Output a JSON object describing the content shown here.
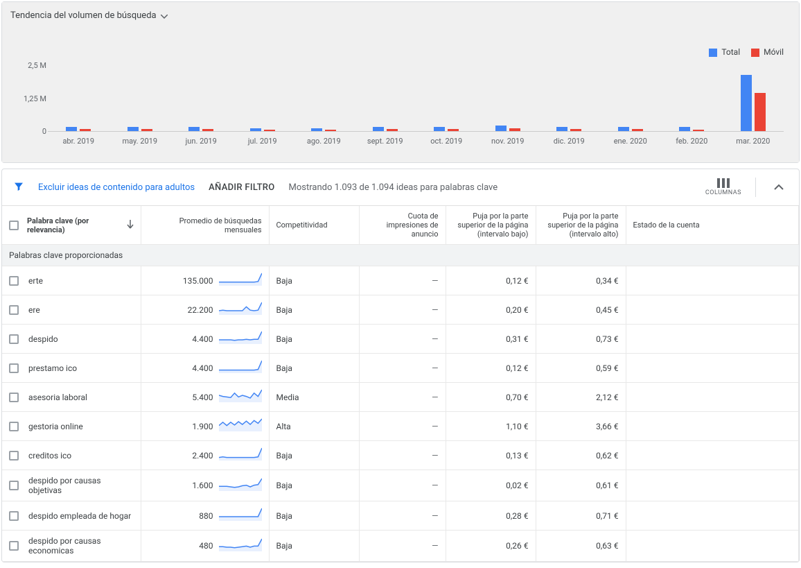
{
  "chart": {
    "title": "Tendencia del volumen de búsqueda",
    "legend": {
      "total": "Total",
      "movil": "Móvil"
    },
    "yticks": [
      "2,5 M",
      "1,25 M",
      "0"
    ]
  },
  "chart_data": {
    "type": "bar",
    "title": "Tendencia del volumen de búsqueda",
    "xlabel": "",
    "ylabel": "",
    "ylim": [
      0,
      2500000
    ],
    "categories": [
      "abr. 2019",
      "may. 2019",
      "jun. 2019",
      "jul. 2019",
      "ago. 2019",
      "sept. 2019",
      "oct. 2019",
      "nov. 2019",
      "dic. 2019",
      "ene. 2020",
      "feb. 2020",
      "mar. 2020"
    ],
    "series": [
      {
        "name": "Total",
        "color": "#4285f4",
        "values": [
          150000,
          150000,
          150000,
          110000,
          110000,
          150000,
          150000,
          200000,
          150000,
          150000,
          160000,
          2000000
        ]
      },
      {
        "name": "Móvil",
        "color": "#ea4335",
        "values": [
          80000,
          80000,
          80000,
          60000,
          60000,
          70000,
          70000,
          90000,
          70000,
          70000,
          50000,
          1350000
        ]
      }
    ]
  },
  "toolbar": {
    "exclude_adult": "Excluir ideas de contenido para adultos",
    "add_filter": "AÑADIR FILTRO",
    "status": "Mostrando 1.093 de 1.094 ideas para palabras clave",
    "columns": "COLUMNAS"
  },
  "table": {
    "headers": {
      "keyword": "Palabra clave (por relevancia)",
      "avg": "Promedio de búsquedas mensuales",
      "comp": "Competitividad",
      "quota": "Cuota de impresiones de anuncio",
      "bid_low": "Puja por la parte superior de la página (intervalo bajo)",
      "bid_high": "Puja por la parte superior de la página (intervalo alto)",
      "account": "Estado de la cuenta"
    },
    "section": "Palabras clave proporcionadas",
    "dash": "—",
    "rows": [
      {
        "kw": "erte",
        "avg": "135.000",
        "comp": "Baja",
        "low": "0,12 €",
        "high": "0,34 €",
        "spark": [
          4,
          4,
          4,
          4,
          4,
          4,
          4,
          4,
          4,
          4,
          5,
          20
        ]
      },
      {
        "kw": "ere",
        "avg": "22.200",
        "comp": "Baja",
        "low": "0,20 €",
        "high": "0,45 €",
        "spark": [
          5,
          6,
          5,
          5,
          5,
          5,
          5,
          12,
          6,
          5,
          6,
          20
        ]
      },
      {
        "kw": "despido",
        "avg": "4.400",
        "comp": "Baja",
        "low": "0,31 €",
        "high": "0,73 €",
        "spark": [
          5,
          5,
          5,
          5,
          4,
          5,
          5,
          6,
          5,
          6,
          6,
          20
        ]
      },
      {
        "kw": "prestamo ico",
        "avg": "4.400",
        "comp": "Baja",
        "low": "0,12 €",
        "high": "0,59 €",
        "spark": [
          3,
          3,
          3,
          3,
          3,
          3,
          3,
          3,
          3,
          3,
          4,
          20
        ]
      },
      {
        "kw": "asesoria laboral",
        "avg": "5.400",
        "comp": "Media",
        "low": "0,70 €",
        "high": "2,12 €",
        "spark": [
          10,
          8,
          7,
          6,
          14,
          7,
          10,
          8,
          5,
          14,
          8,
          20
        ]
      },
      {
        "kw": "gestoria online",
        "avg": "1.900",
        "comp": "Alta",
        "low": "1,10 €",
        "high": "3,66 €",
        "spark": [
          8,
          14,
          8,
          14,
          9,
          15,
          10,
          16,
          10,
          17,
          12,
          20
        ]
      },
      {
        "kw": "creditos ico",
        "avg": "2.400",
        "comp": "Baja",
        "low": "0,13 €",
        "high": "0,62 €",
        "spark": [
          3,
          4,
          3,
          3,
          3,
          3,
          3,
          3,
          3,
          3,
          4,
          20
        ]
      },
      {
        "kw": "despido por causas objetivas",
        "avg": "1.600",
        "comp": "Baja",
        "low": "0,02 €",
        "high": "0,61 €",
        "spark": [
          6,
          6,
          6,
          5,
          4,
          5,
          7,
          8,
          5,
          8,
          9,
          20
        ]
      },
      {
        "kw": "despido empleada de hogar",
        "avg": "880",
        "comp": "Baja",
        "low": "0,28 €",
        "high": "0,71 €",
        "spark": [
          5,
          5,
          5,
          5,
          5,
          5,
          5,
          5,
          5,
          5,
          5,
          20
        ]
      },
      {
        "kw": "despido por causas economicas",
        "avg": "480",
        "comp": "Baja",
        "low": "0,26 €",
        "high": "0,63 €",
        "spark": [
          6,
          6,
          5,
          5,
          4,
          5,
          6,
          7,
          5,
          7,
          7,
          20
        ]
      }
    ]
  }
}
